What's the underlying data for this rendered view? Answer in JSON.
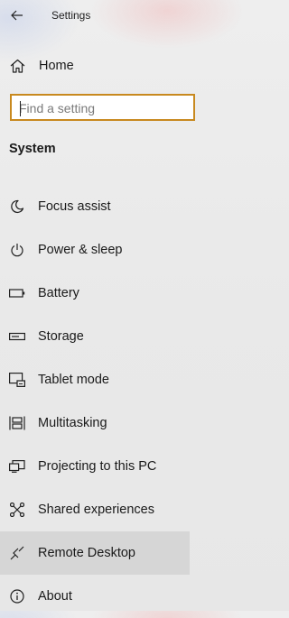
{
  "window": {
    "title": "Settings"
  },
  "nav": {
    "home_label": "Home"
  },
  "search": {
    "placeholder": "Find a setting",
    "value": ""
  },
  "section": {
    "heading": "System"
  },
  "items": [
    {
      "label": "Focus assist",
      "icon": "moon-icon",
      "selected": false
    },
    {
      "label": "Power & sleep",
      "icon": "power-icon",
      "selected": false
    },
    {
      "label": "Battery",
      "icon": "battery-icon",
      "selected": false
    },
    {
      "label": "Storage",
      "icon": "storage-icon",
      "selected": false
    },
    {
      "label": "Tablet mode",
      "icon": "tablet-mode-icon",
      "selected": false
    },
    {
      "label": "Multitasking",
      "icon": "multitasking-icon",
      "selected": false
    },
    {
      "label": "Projecting to this PC",
      "icon": "projecting-icon",
      "selected": false
    },
    {
      "label": "Shared experiences",
      "icon": "shared-experiences-icon",
      "selected": false
    },
    {
      "label": "Remote Desktop",
      "icon": "remote-desktop-icon",
      "selected": true
    },
    {
      "label": "About",
      "icon": "info-icon",
      "selected": false
    }
  ],
  "colors": {
    "search_border": "#c8891f",
    "selected_background": "#d6d6d6",
    "text": "#1a1a1a"
  }
}
